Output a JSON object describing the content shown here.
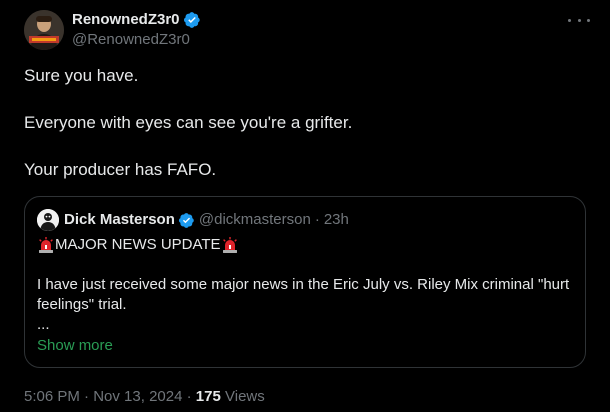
{
  "author": {
    "display_name": "RenownedZ3r0",
    "handle": "@RenownedZ3r0",
    "avatar_icon": "avatar-image",
    "verified": true,
    "verified_icon": "verified-badge-icon"
  },
  "menu": {
    "icon": "more-options-icon"
  },
  "tweet": {
    "paragraphs": [
      "Sure you have.",
      "Everyone with eyes can see you're a grifter.",
      "Your producer has FAFO."
    ]
  },
  "quote": {
    "display_name": "Dick Masterson",
    "handle": "@dickmasterson",
    "separator": "·",
    "time": "23h",
    "verified": true,
    "headline_emoji": "rotating-light-icon",
    "headline": "MAJOR NEWS UPDATE",
    "paragraph": "I have just received some major news in the Eric July vs. Riley Mix criminal \"hurt feelings\" trial.",
    "ellipsis": "...",
    "show_more": "Show more"
  },
  "meta": {
    "time": "5:06 PM",
    "separator": "·",
    "date": "Nov 13, 2024",
    "views_count": "175",
    "views_label": "Views"
  },
  "colors": {
    "background": "#000000",
    "text": "#e7e9ea",
    "muted": "#71767b",
    "verified": "#1d9bf0",
    "border": "#2f3336",
    "show_more": "#2a9d55"
  }
}
